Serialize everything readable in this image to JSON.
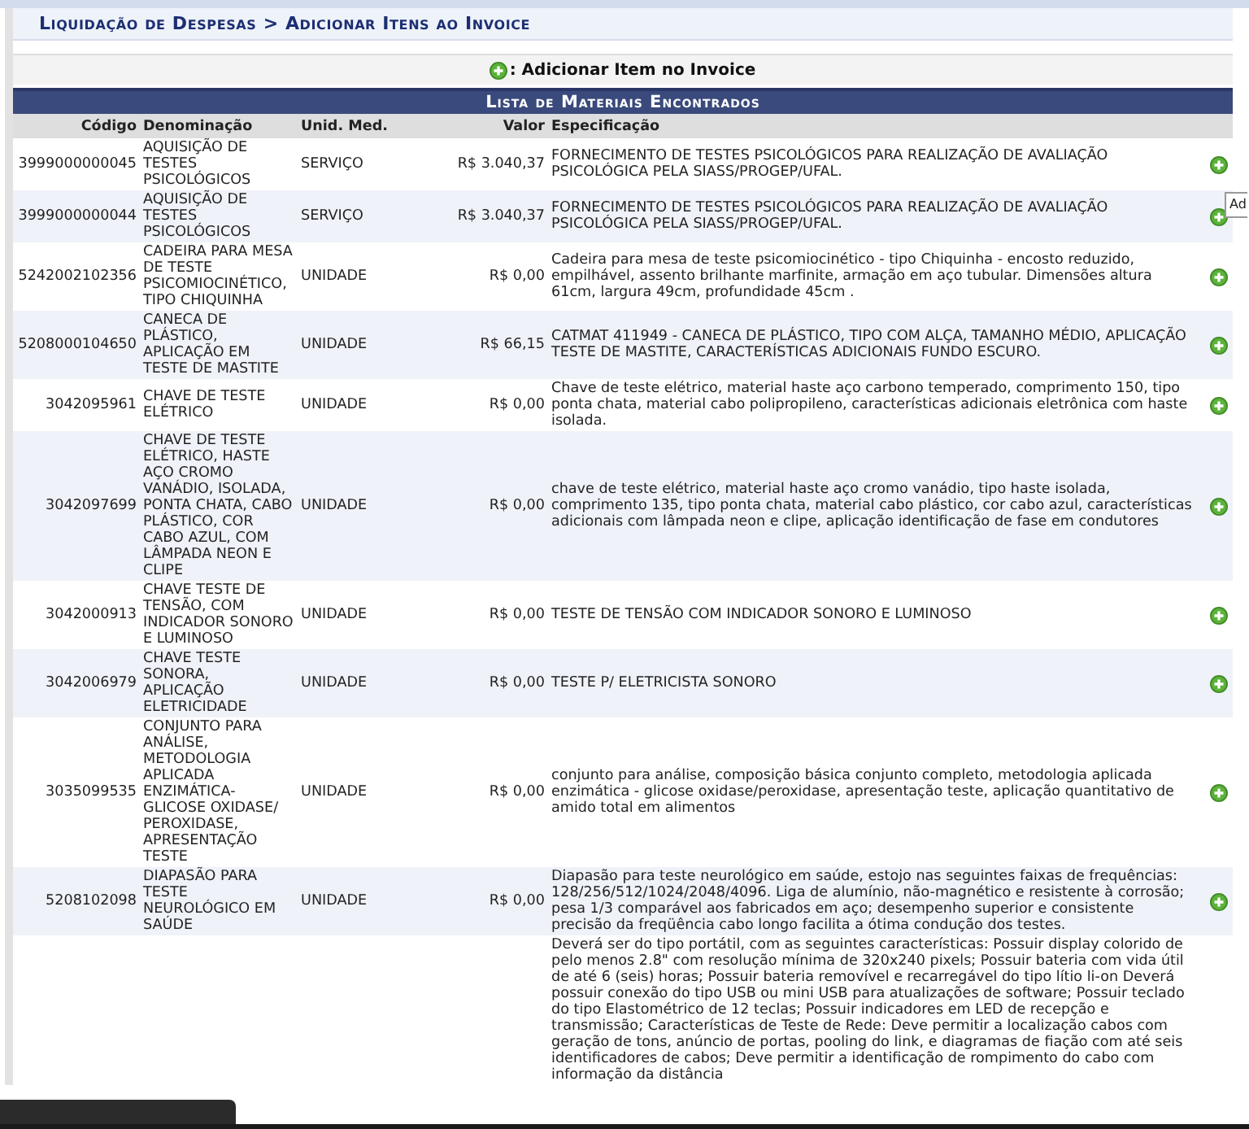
{
  "breadcrumb": "Liquidação de Despesas > Adicionar Itens ao Invoice",
  "legend": {
    "label": ": Adicionar Item no Invoice"
  },
  "table": {
    "caption": "Lista de Materiais Encontrados",
    "columns": [
      "Código",
      "Denominação",
      "Unid. Med.",
      "Valor",
      "Especificação"
    ],
    "rows": [
      {
        "kind": "item",
        "codigo": "3999000000045",
        "denominacao": "AQUISIÇÃO DE TESTES PSICOLÓGICOS",
        "unidade": "SERVIÇO",
        "valor": "R$ 3.040,37",
        "especificacao": "FORNECIMENTO DE TESTES PSICOLÓGICOS PARA REALIZAÇÃO DE AVALIAÇÃO PSICOLÓGICA PELA SIASS/PROGEP/UFAL."
      },
      {
        "kind": "item",
        "codigo": "3999000000044",
        "denominacao": "AQUISIÇÃO DE TESTES PSICOLÓGICOS",
        "unidade": "SERVIÇO",
        "valor": "R$ 3.040,37",
        "especificacao": "FORNECIMENTO DE TESTES PSICOLÓGICOS PARA REALIZAÇÃO DE AVALIAÇÃO PSICOLÓGICA PELA SIASS/PROGEP/UFAL."
      },
      {
        "kind": "item",
        "codigo": "5242002102356",
        "denominacao": "CADEIRA PARA MESA DE TESTE PSICOMIOCINÉTICO, TIPO CHIQUINHA",
        "unidade": "UNIDADE",
        "valor": "R$ 0,00",
        "especificacao": "Cadeira para mesa de teste psicomiocinético - tipo Chiquinha - encosto reduzido, empilhável, assento brilhante marfinite, armação em aço tubular. Dimensões altura 61cm, largura 49cm, profundidade 45cm ."
      },
      {
        "kind": "item",
        "codigo": "5208000104650",
        "denominacao": "CANECA DE PLÁSTICO, APLICAÇÃO EM TESTE DE MASTITE",
        "unidade": "UNIDADE",
        "valor": "R$ 66,15",
        "especificacao": "CATMAT 411949 - CANECA DE PLÁSTICO, TIPO COM ALÇA, TAMANHO MÉDIO, APLICAÇÃO TESTE DE MASTITE, CARACTERÍSTICAS ADICIONAIS FUNDO ESCURO."
      },
      {
        "kind": "item",
        "codigo": "3042095961",
        "denominacao": "CHAVE DE TESTE ELÉTRICO",
        "unidade": "UNIDADE",
        "valor": "R$ 0,00",
        "especificacao": "Chave de teste elétrico, material haste aço carbono temperado, comprimento 150, tipo ponta chata, material cabo polipropileno, características adicionais eletrônica com haste isolada."
      },
      {
        "kind": "item",
        "codigo": "3042097699",
        "denominacao": "CHAVE DE TESTE ELÉTRICO, HASTE AÇO CROMO VANÁDIO, ISOLADA, PONTA CHATA, CABO PLÁSTICO, COR CABO AZUL, COM LÂMPADA NEON E CLIPE",
        "unidade": "UNIDADE",
        "valor": "R$ 0,00",
        "especificacao": "chave de teste elétrico, material haste aço cromo vanádio, tipo haste isolada, comprimento 135, tipo ponta chata, material cabo plástico, cor cabo azul, características adicionais com lâmpada neon e clipe, aplicação identificação de fase em condutores"
      },
      {
        "kind": "item",
        "codigo": "3042000913",
        "denominacao": "CHAVE TESTE DE TENSÃO, COM INDICADOR SONORO E LUMINOSO",
        "unidade": "UNIDADE",
        "valor": "R$ 0,00",
        "especificacao": "TESTE DE TENSÃO COM INDICADOR SONORO E LUMINOSO"
      },
      {
        "kind": "item",
        "codigo": "3042006979",
        "denominacao": "CHAVE TESTE SONORA, APLICAÇÃO ELETRICIDADE",
        "unidade": "UNIDADE",
        "valor": "R$ 0,00",
        "especificacao": "TESTE P/ ELETRICISTA SONORO"
      },
      {
        "kind": "item",
        "codigo": "3035099535",
        "denominacao": "CONJUNTO PARA ANÁLISE, METODOLOGIA APLICADA ENZIMÁTICA-GLICOSE OXIDASE/ PEROXIDASE, APRESENTAÇÃO TESTE",
        "unidade": "UNIDADE",
        "valor": "R$ 0,00",
        "especificacao": "conjunto para análise, composição básica conjunto completo, metodologia aplicada enzimática - glicose oxidase/peroxidase, apresentação teste, aplicação quantitativo de amido total em alimentos"
      },
      {
        "kind": "item",
        "codigo": "5208102098",
        "denominacao": "DIAPASÃO PARA TESTE NEUROLÓGICO EM SAÚDE",
        "unidade": "UNIDADE",
        "valor": "R$ 0,00",
        "especificacao": "Diapasão para teste neurológico em saúde, estojo nas seguintes faixas de frequências: 128/256/512/1024/2048/4096. Liga de alumínio, não-magnético e resistente à corrosão; pesa 1/3 comparável aos fabricados em aço; desempenho superior e consistente precisão da freqüência cabo longo facilita a ótima condução dos testes."
      },
      {
        "kind": "cut",
        "especificacao": "Deverá ser do tipo portátil, com as seguintes características: Possuir display colorido de pelo menos 2.8\" com resolução mínima de 320x240 pixels; Possuir bateria com vida útil de até 6 (seis) horas; Possuir bateria removível e recarregável do tipo lítio li-on Deverá possuir conexão do tipo USB ou mini USB para atualizações de software; Possuir teclado do tipo Elastométrico de 12 teclas; Possuir indicadores em LED de recepção e transmissão; Características de Teste de Rede: Deve permitir a localização cabos com geração de tons, anúncio de portas, pooling do link, e diagramas de fiação com até seis identificadores de cabos; Deve permitir a identificação de rompimento do cabo com informação da distância"
      }
    ]
  },
  "tooltip": "Ad"
}
